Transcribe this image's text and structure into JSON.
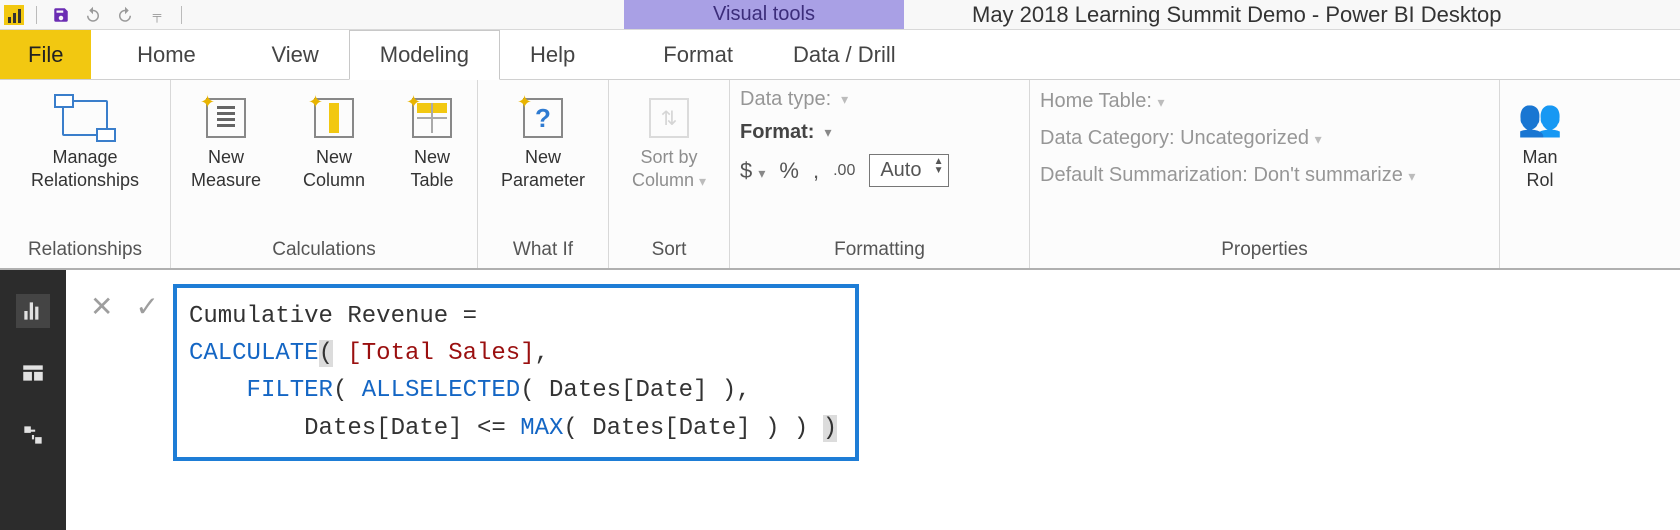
{
  "titlebar": {
    "context_tab": "Visual tools",
    "window_title": "May 2018 Learning Summit Demo - Power BI Desktop"
  },
  "tabs": {
    "file": "File",
    "home": "Home",
    "view": "View",
    "modeling": "Modeling",
    "help": "Help",
    "format": "Format",
    "datadrill": "Data / Drill"
  },
  "ribbon": {
    "relationships": {
      "group": "Relationships",
      "manage": "Manage\nRelationships"
    },
    "calculations": {
      "group": "Calculations",
      "measure": "New\nMeasure",
      "column": "New\nColumn",
      "table": "New\nTable"
    },
    "whatif": {
      "group": "What If",
      "parameter": "New\nParameter"
    },
    "sort": {
      "group": "Sort",
      "sortby": "Sort by\nColumn"
    },
    "formatting": {
      "group": "Formatting",
      "datatype": "Data type:",
      "format": "Format:",
      "currency": "$",
      "percent": "%",
      "comma": ",",
      "decimals": ".00",
      "auto": "Auto"
    },
    "properties": {
      "group": "Properties",
      "home_table": "Home Table:",
      "data_category_label": "Data Category:",
      "data_category_value": "Uncategorized",
      "summarization_label": "Default Summarization:",
      "summarization_value": "Don't summarize"
    },
    "security": {
      "manage": "Man\nRol"
    }
  },
  "formula": {
    "line1_plain": "Cumulative Revenue =",
    "calc": "CALCULATE",
    "filter": "FILTER",
    "allsel": "ALLSELECTED",
    "max": "MAX",
    "total_sales": "[Total Sales]",
    "dates": "Dates[Date]"
  }
}
